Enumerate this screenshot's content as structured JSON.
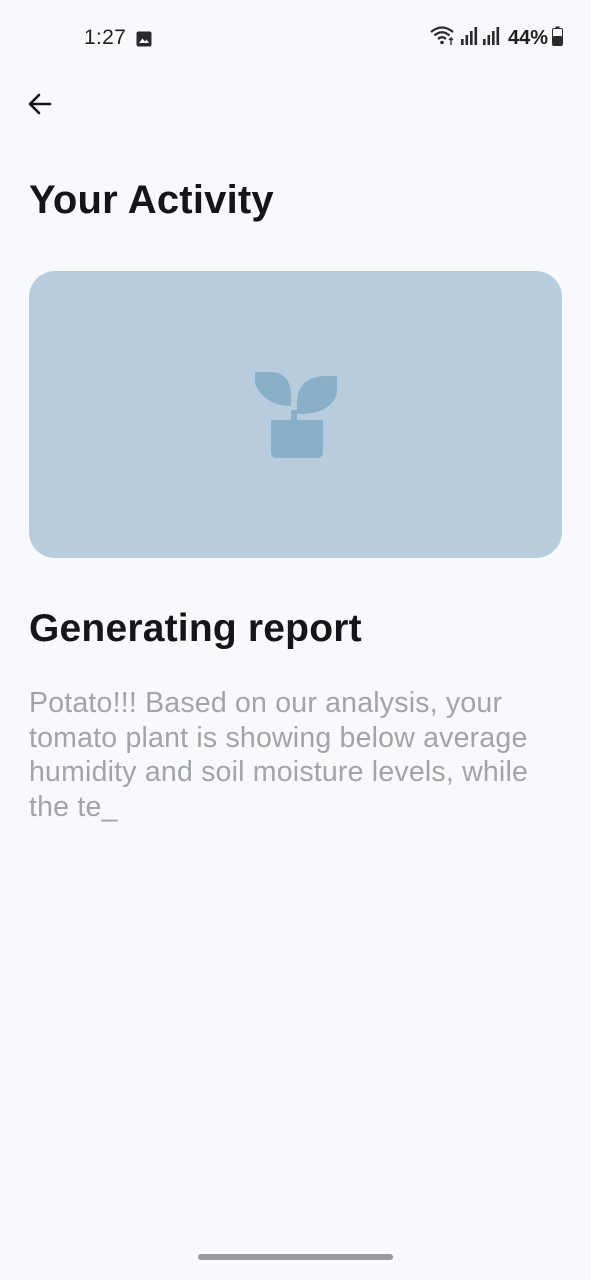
{
  "status_bar": {
    "time": "1:27",
    "battery": "44%",
    "icons": [
      "gallery-icon",
      "wifi-icon",
      "signal-icon",
      "signal-icon",
      "battery-icon"
    ]
  },
  "header": {
    "back_icon": "arrow-left-icon",
    "title": "Your Activity"
  },
  "hero": {
    "icon": "plant-pot-icon",
    "background_color": "#b7cddd",
    "icon_color": "#8ab0c9"
  },
  "report": {
    "title": "Generating report",
    "text": "Potato!!! Based on our analysis, your tomato plant is showing below average humidity and soil moisture levels, while the te_"
  }
}
